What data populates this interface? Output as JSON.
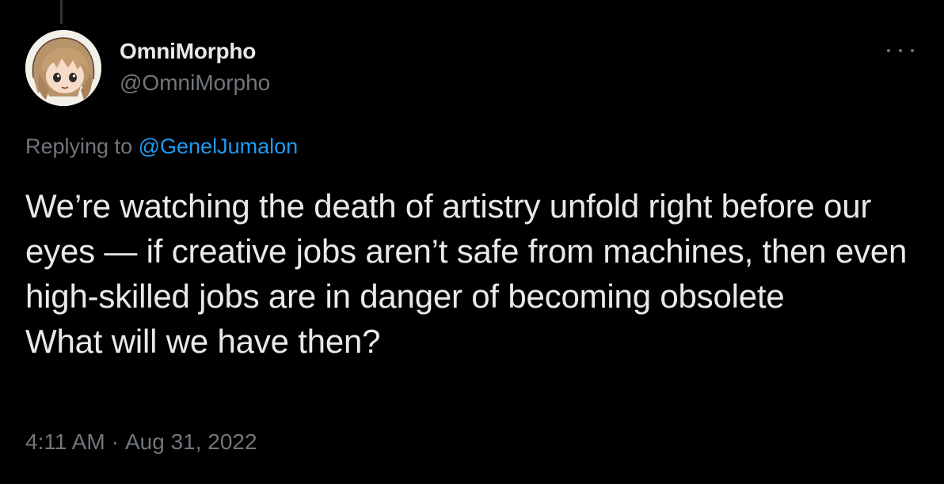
{
  "author": {
    "display_name": "OmniMorpho",
    "handle": "@OmniMorpho",
    "avatar_icon": "anime-avatar-icon"
  },
  "reply": {
    "prefix": "Replying to",
    "mention": "@GenelJumalon"
  },
  "tweet": {
    "text": "We’re watching the death of artistry unfold right before our eyes — if creative jobs aren’t safe from machines, then even high-skilled jobs are in danger of becoming obsolete\nWhat will we have then?"
  },
  "meta": {
    "time": "4:11 AM",
    "separator": "·",
    "date": "Aug 31, 2022"
  },
  "colors": {
    "background": "#000000",
    "text": "#e7e9ea",
    "secondary": "#71767b",
    "link": "#1d9bf0"
  },
  "icons": {
    "more": "more-options-icon"
  }
}
